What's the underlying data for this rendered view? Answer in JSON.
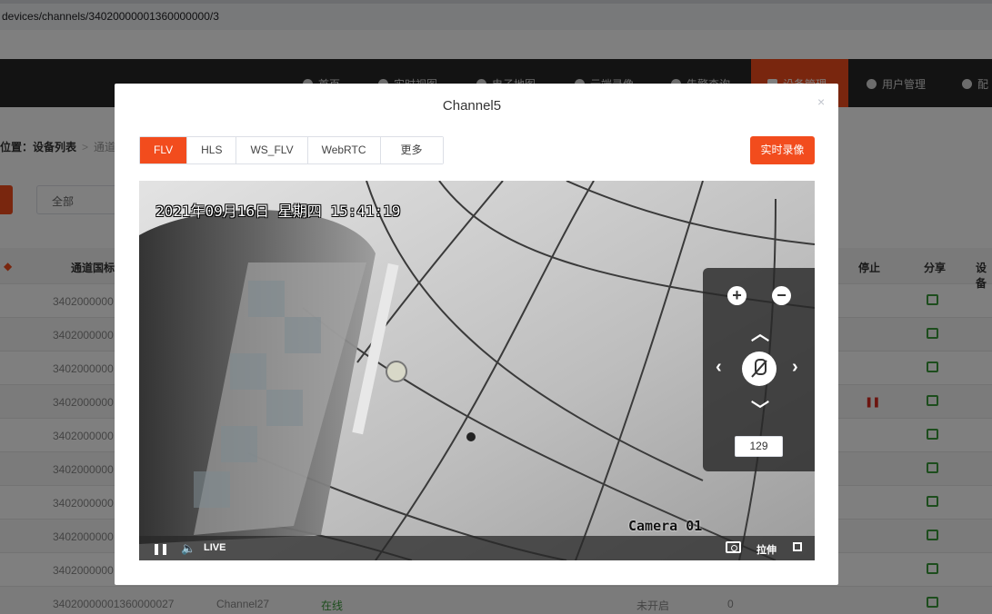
{
  "browser": {
    "url": "devices/channels/34020000001360000000/3"
  },
  "header": {
    "nav": [
      {
        "label": "首页",
        "icon": "home-icon"
      },
      {
        "label": "实时视图",
        "icon": "video-icon"
      },
      {
        "label": "电子地图",
        "icon": "map-icon"
      },
      {
        "label": "云端录像",
        "icon": "cloud-icon"
      },
      {
        "label": "告警查询",
        "icon": "alarm-icon"
      },
      {
        "label": "设备管理",
        "icon": "device-icon",
        "active": true
      },
      {
        "label": "用户管理",
        "icon": "user-icon"
      },
      {
        "label": "配",
        "icon": "gear-icon"
      }
    ],
    "accent": "#f24c1d"
  },
  "page": {
    "breadcrumb": {
      "prefix": "位置：",
      "current": "设备列表",
      "next": "通道"
    },
    "filter": {
      "value": "全部"
    },
    "table": {
      "headers": {
        "col_id": "通道国标",
        "col_stop": "停止",
        "col_share": "分享",
        "col_more": "设备"
      },
      "rows": [
        "3402000000",
        "3402000000",
        "3402000000",
        "3402000000",
        "3402000000",
        "3402000000",
        "3402000000",
        "3402000000",
        "3402000000"
      ],
      "last_row": {
        "id": "34020000001360000027",
        "name": "Channel27",
        "status": "在线",
        "record": "未开启",
        "count": "0"
      }
    }
  },
  "modal": {
    "title": "Channel5",
    "close": "×",
    "tabs": [
      "FLV",
      "HLS",
      "WS_FLV",
      "WebRTC",
      "更多"
    ],
    "active_tab": "FLV",
    "record_button": "实时录像",
    "video": {
      "osd_time": "2021年09月16日 星期四 15:41:19",
      "osd_camera": "Camera 01",
      "controls": {
        "live": "LIVE",
        "stretch": "拉伸"
      }
    },
    "ptz": {
      "zoom_in": "+",
      "zoom_out": "−",
      "up": "︿",
      "down": "﹀",
      "left": "‹",
      "right": "›",
      "speed": "129"
    }
  }
}
